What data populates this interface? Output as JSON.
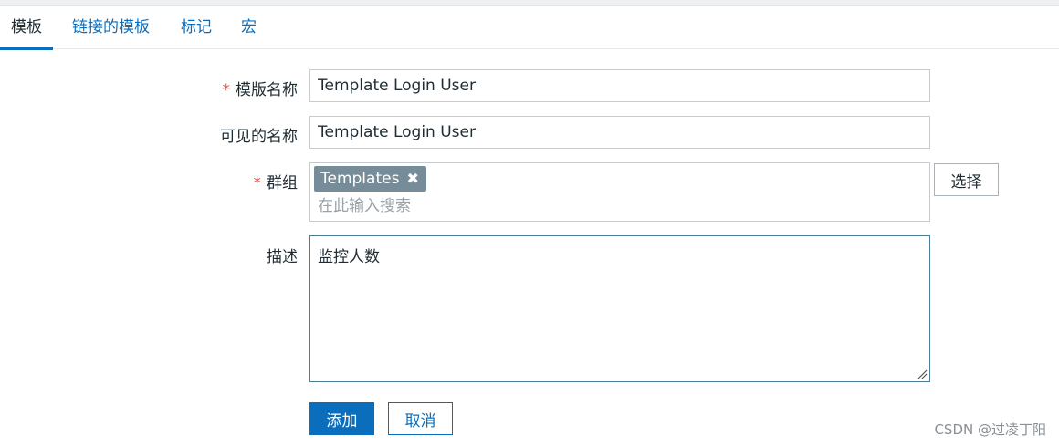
{
  "tabs": [
    {
      "label": "模板",
      "active": true
    },
    {
      "label": "链接的模板",
      "active": false
    },
    {
      "label": "标记",
      "active": false
    },
    {
      "label": "宏",
      "active": false
    }
  ],
  "form": {
    "required_mark": "*",
    "template_name": {
      "label": "模版名称",
      "value": "Template Login User",
      "required": true
    },
    "visible_name": {
      "label": "可见的名称",
      "value": "Template Login User"
    },
    "groups": {
      "label": "群组",
      "required": true,
      "chips": [
        "Templates"
      ],
      "chip_close_glyph": "✖",
      "search_placeholder": "在此输入搜索",
      "select_button": "选择"
    },
    "description": {
      "label": "描述",
      "value": "监控人数"
    }
  },
  "actions": {
    "add": "添加",
    "cancel": "取消"
  },
  "watermark": "CSDN @过凌丁阳",
  "colors": {
    "accent": "#0a6ebd",
    "chip_bg": "#768d99",
    "required": "#d64e4e"
  },
  "icons": {
    "chip_close": "close-icon",
    "resize": "resize-grip-icon"
  }
}
